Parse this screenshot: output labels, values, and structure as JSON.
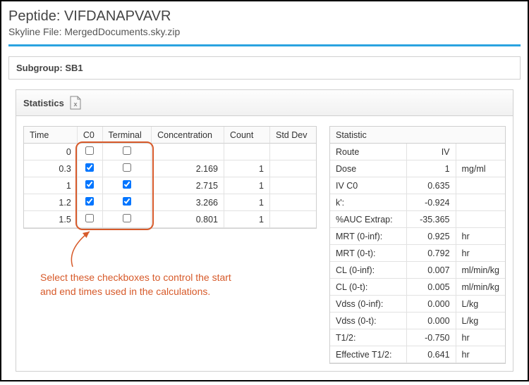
{
  "header": {
    "peptide_label": "Peptide:",
    "peptide": "VIFDANAPVAVR",
    "skyline_label": "Skyline File:",
    "skyline_file": "MergedDocuments.sky.zip"
  },
  "subgroup": {
    "label": "Subgroup:",
    "name": "SB1"
  },
  "statistics_panel": {
    "title": "Statistics",
    "export_icon": "excel-export-icon"
  },
  "time_table": {
    "headers": {
      "time": "Time",
      "c0": "C0",
      "terminal": "Terminal",
      "concentration": "Concentration",
      "count": "Count",
      "stddev": "Std Dev"
    },
    "rows": [
      {
        "time": "0",
        "c0": false,
        "terminal": false,
        "concentration": "",
        "count": "",
        "stddev": ""
      },
      {
        "time": "0.3",
        "c0": true,
        "terminal": false,
        "concentration": "2.169",
        "count": "1",
        "stddev": ""
      },
      {
        "time": "1",
        "c0": true,
        "terminal": true,
        "concentration": "2.715",
        "count": "1",
        "stddev": ""
      },
      {
        "time": "1.2",
        "c0": true,
        "terminal": true,
        "concentration": "3.266",
        "count": "1",
        "stddev": ""
      },
      {
        "time": "1.5",
        "c0": false,
        "terminal": false,
        "concentration": "0.801",
        "count": "1",
        "stddev": ""
      }
    ]
  },
  "stat_table": {
    "header": "Statistic",
    "rows": [
      {
        "name": "Route",
        "value": "IV",
        "unit": ""
      },
      {
        "name": "Dose",
        "value": "1",
        "unit": "mg/ml"
      },
      {
        "name": "IV C0",
        "value": "0.635",
        "unit": ""
      },
      {
        "name": "k':",
        "value": "-0.924",
        "unit": ""
      },
      {
        "name": "%AUC Extrap:",
        "value": "-35.365",
        "unit": ""
      },
      {
        "name": "MRT (0-inf):",
        "value": "0.925",
        "unit": "hr"
      },
      {
        "name": "MRT (0-t):",
        "value": "0.792",
        "unit": "hr"
      },
      {
        "name": "CL (0-inf):",
        "value": "0.007",
        "unit": "ml/min/kg"
      },
      {
        "name": "CL (0-t):",
        "value": "0.005",
        "unit": "ml/min/kg"
      },
      {
        "name": "Vdss (0-inf):",
        "value": "0.000",
        "unit": "L/kg"
      },
      {
        "name": "Vdss (0-t):",
        "value": "0.000",
        "unit": "L/kg"
      },
      {
        "name": "T1/2:",
        "value": "-0.750",
        "unit": "hr"
      },
      {
        "name": "Effective T1/2:",
        "value": "0.641",
        "unit": "hr"
      }
    ]
  },
  "annotation": {
    "text": "Select these checkboxes to control the start and end times used in the calculations."
  },
  "colors": {
    "accent_blue": "#2aa3e0",
    "annotation_orange": "#d75a2a"
  }
}
